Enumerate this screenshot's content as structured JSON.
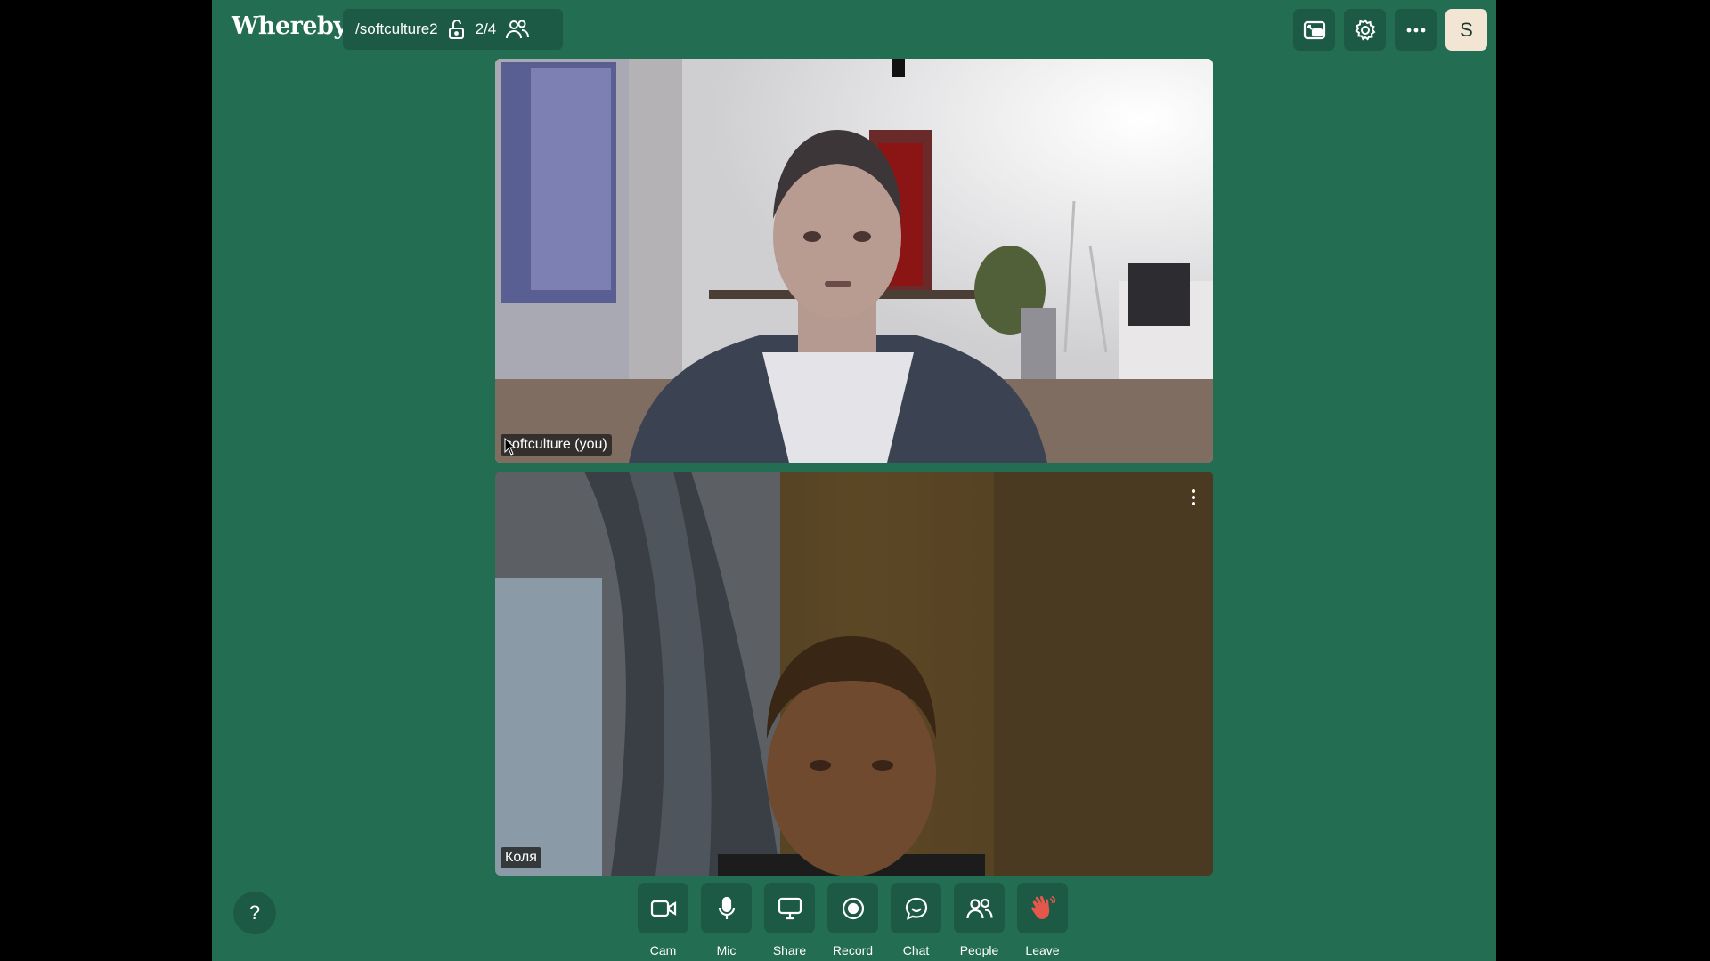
{
  "app": {
    "logo": "Whereby"
  },
  "header": {
    "room_name": "/softculture2",
    "participant_count": "2/4",
    "lock_icon": "unlock-icon",
    "people_icon": "people-icon",
    "actions": [
      {
        "name": "picture-in-picture-button",
        "icon": "pip-icon"
      },
      {
        "name": "settings-button",
        "icon": "gear-icon"
      },
      {
        "name": "more-button",
        "icon": "more-icon"
      }
    ],
    "avatar_initial": "S"
  },
  "participants": [
    {
      "name": "softculture (you)",
      "is_self": true
    },
    {
      "name": "Коля",
      "is_self": false
    }
  ],
  "help": {
    "label": "?"
  },
  "toolbar": {
    "items": [
      {
        "label": "Cam",
        "icon": "camera-icon"
      },
      {
        "label": "Mic",
        "icon": "mic-icon"
      },
      {
        "label": "Share",
        "icon": "screen-share-icon"
      },
      {
        "label": "Record",
        "icon": "record-icon"
      },
      {
        "label": "Chat",
        "icon": "chat-icon"
      },
      {
        "label": "People",
        "icon": "people-icon"
      },
      {
        "label": "Leave",
        "icon": "wave-hand-icon"
      }
    ]
  },
  "colors": {
    "background": "#236d52",
    "button_bg": "#1d5a45",
    "avatar_bg": "#f3e5d4",
    "leave_icon": "#e5574a"
  }
}
